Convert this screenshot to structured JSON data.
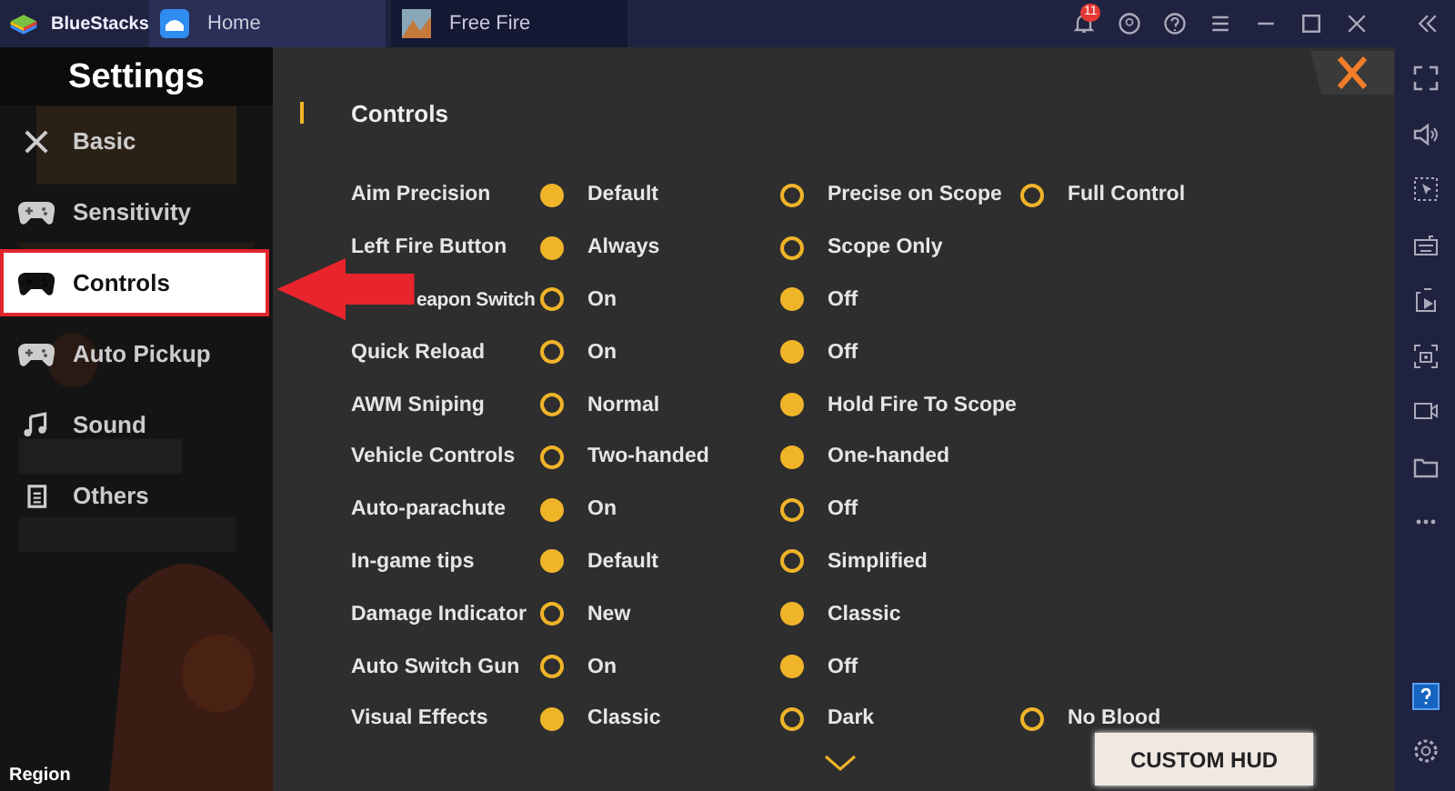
{
  "app": {
    "name": "BlueStacks",
    "notification_count": "11"
  },
  "tabs": [
    {
      "label": "Home",
      "selected": false
    },
    {
      "label": "Free Fire",
      "selected": true
    }
  ],
  "settings": {
    "title": "Settings",
    "footer": "Region",
    "items": [
      {
        "label": "Basic",
        "selected": false
      },
      {
        "label": "Sensitivity",
        "selected": false
      },
      {
        "label": "Controls",
        "selected": true
      },
      {
        "label": "Auto Pickup",
        "selected": false
      },
      {
        "label": "Sound",
        "selected": false
      },
      {
        "label": "Others",
        "selected": false
      }
    ]
  },
  "panel": {
    "heading": "Controls",
    "button": "CUSTOM HUD",
    "rows": [
      {
        "label": "Aim Precision",
        "options": [
          {
            "label": "Default",
            "selected": true
          },
          {
            "label": "Precise on Scope",
            "selected": false
          },
          {
            "label": "Full Control",
            "selected": false
          }
        ]
      },
      {
        "label": "Left Fire Button",
        "options": [
          {
            "label": "Always",
            "selected": true
          },
          {
            "label": "Scope Only",
            "selected": false
          }
        ]
      },
      {
        "label": "eapon Switch",
        "covered": true,
        "options": [
          {
            "label": "On",
            "selected": false
          },
          {
            "label": "Off",
            "selected": true
          }
        ]
      },
      {
        "label": "Quick Reload",
        "options": [
          {
            "label": "On",
            "selected": false
          },
          {
            "label": "Off",
            "selected": true
          }
        ]
      },
      {
        "label": "AWM Sniping",
        "options": [
          {
            "label": "Normal",
            "selected": false
          },
          {
            "label": "Hold Fire To Scope",
            "selected": true
          }
        ]
      },
      {
        "label": "Vehicle Controls",
        "options": [
          {
            "label": "Two-handed",
            "selected": false
          },
          {
            "label": "One-handed",
            "selected": true
          }
        ]
      },
      {
        "label": "Auto-parachute",
        "options": [
          {
            "label": "On",
            "selected": true
          },
          {
            "label": "Off",
            "selected": false
          }
        ]
      },
      {
        "label": "In-game tips",
        "options": [
          {
            "label": "Default",
            "selected": true
          },
          {
            "label": "Simplified",
            "selected": false
          }
        ]
      },
      {
        "label": "Damage Indicator",
        "options": [
          {
            "label": "New",
            "selected": false
          },
          {
            "label": "Classic",
            "selected": true
          }
        ]
      },
      {
        "label": "Auto Switch Gun",
        "options": [
          {
            "label": "On",
            "selected": false
          },
          {
            "label": "Off",
            "selected": true
          }
        ]
      },
      {
        "label": "Visual Effects",
        "options": [
          {
            "label": "Classic",
            "selected": true
          },
          {
            "label": "Dark",
            "selected": false
          },
          {
            "label": "No Blood",
            "selected": false
          }
        ]
      }
    ]
  }
}
